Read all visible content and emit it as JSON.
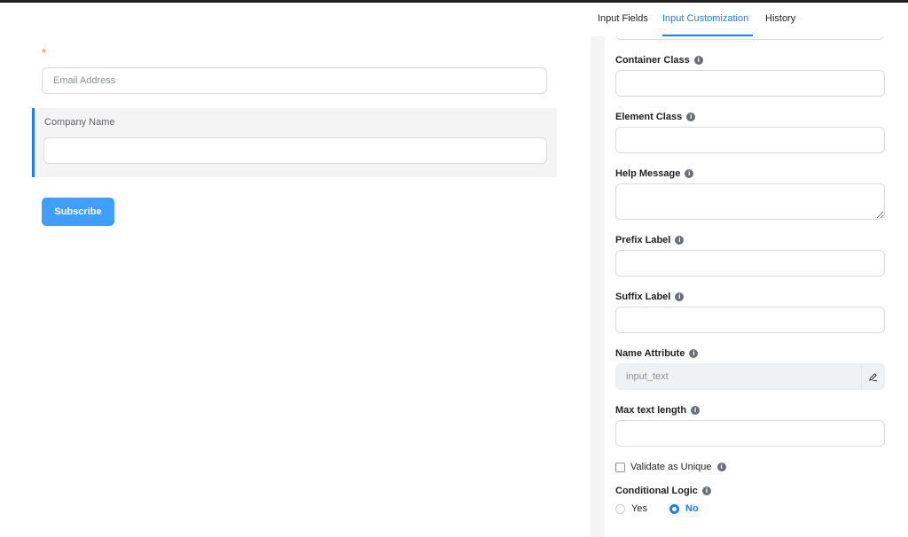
{
  "form": {
    "required_marker": "*",
    "email_placeholder": "Email Address",
    "company_label": "Company Name",
    "subscribe_label": "Subscribe"
  },
  "tabs": [
    {
      "label": "Input Fields",
      "active": false
    },
    {
      "label": "Input Customization",
      "active": true
    },
    {
      "label": "History",
      "active": false
    }
  ],
  "settings": {
    "container_class": "Container Class",
    "element_class": "Element Class",
    "help_message": "Help Message",
    "prefix_label": "Prefix Label",
    "suffix_label": "Suffix Label",
    "name_attribute": "Name Attribute",
    "name_attribute_value": "input_text",
    "max_text_length": "Max text length",
    "validate_unique": "Validate as Unique",
    "conditional_logic": "Conditional Logic",
    "yes": "Yes",
    "no": "No",
    "info_glyph": "i"
  },
  "colors": {
    "accent": "#1a7efb",
    "button": "#409eff",
    "required": "#f56c6c"
  },
  "icons": [
    "info-icon",
    "pencil-icon"
  ]
}
